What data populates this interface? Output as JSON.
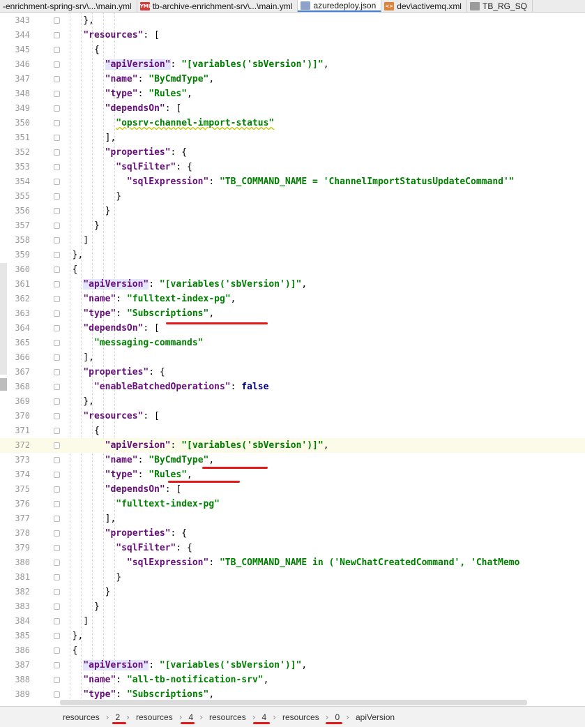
{
  "tabs": [
    {
      "label": "-enrichment-spring-srv\\...\\main.yml",
      "icon": "",
      "active": false
    },
    {
      "label": "tb-archive-enrichment-srv\\...\\main.yml",
      "icon": "yml",
      "active": false
    },
    {
      "label": "azuredeploy.json",
      "icon": "json",
      "active": true
    },
    {
      "label": "dev\\activemq.xml",
      "icon": "xml",
      "active": false
    },
    {
      "label": "TB_RG_SQ",
      "icon": "cfg",
      "active": false
    }
  ],
  "editor": {
    "current_line": 372,
    "lines": [
      {
        "n": "343",
        "segs": [
          {
            "t": "    },"
          }
        ]
      },
      {
        "n": "344",
        "segs": [
          {
            "t": "    "
          },
          {
            "t": "\"resources\"",
            "c": "key"
          },
          {
            "t": ": ["
          }
        ]
      },
      {
        "n": "345",
        "segs": [
          {
            "t": "      {"
          }
        ]
      },
      {
        "n": "346",
        "segs": [
          {
            "t": "        "
          },
          {
            "t": "\"apiVersion\"",
            "c": "key hl"
          },
          {
            "t": ": "
          },
          {
            "t": "\"[variables('sbVersion')]\"",
            "c": "str"
          },
          {
            "t": ","
          }
        ]
      },
      {
        "n": "347",
        "segs": [
          {
            "t": "        "
          },
          {
            "t": "\"name\"",
            "c": "key"
          },
          {
            "t": ": "
          },
          {
            "t": "\"ByCmdType\"",
            "c": "str"
          },
          {
            "t": ","
          }
        ]
      },
      {
        "n": "348",
        "segs": [
          {
            "t": "        "
          },
          {
            "t": "\"type\"",
            "c": "key"
          },
          {
            "t": ": "
          },
          {
            "t": "\"Rules\"",
            "c": "str"
          },
          {
            "t": ","
          }
        ]
      },
      {
        "n": "349",
        "segs": [
          {
            "t": "        "
          },
          {
            "t": "\"dependsOn\"",
            "c": "key"
          },
          {
            "t": ": ["
          }
        ]
      },
      {
        "n": "350",
        "segs": [
          {
            "t": "          "
          },
          {
            "t": "\"opsrv-channel-import-status\"",
            "c": "str warn"
          }
        ]
      },
      {
        "n": "351",
        "segs": [
          {
            "t": "        ],"
          }
        ]
      },
      {
        "n": "352",
        "segs": [
          {
            "t": "        "
          },
          {
            "t": "\"properties\"",
            "c": "key"
          },
          {
            "t": ": {"
          }
        ]
      },
      {
        "n": "353",
        "segs": [
          {
            "t": "          "
          },
          {
            "t": "\"sqlFilter\"",
            "c": "key"
          },
          {
            "t": ": {"
          }
        ]
      },
      {
        "n": "354",
        "segs": [
          {
            "t": "            "
          },
          {
            "t": "\"sqlExpression\"",
            "c": "key"
          },
          {
            "t": ": "
          },
          {
            "t": "\"TB_COMMAND_NAME = 'ChannelImportStatusUpdateCommand'\"",
            "c": "str"
          }
        ]
      },
      {
        "n": "355",
        "segs": [
          {
            "t": "          }"
          }
        ]
      },
      {
        "n": "356",
        "segs": [
          {
            "t": "        }"
          }
        ]
      },
      {
        "n": "357",
        "segs": [
          {
            "t": "      }"
          }
        ]
      },
      {
        "n": "358",
        "segs": [
          {
            "t": "    ]"
          }
        ]
      },
      {
        "n": "359",
        "segs": [
          {
            "t": "  },"
          }
        ]
      },
      {
        "n": "360",
        "segs": [
          {
            "t": "  {"
          }
        ]
      },
      {
        "n": "361",
        "segs": [
          {
            "t": "    "
          },
          {
            "t": "\"apiVersion\"",
            "c": "key hl"
          },
          {
            "t": ": "
          },
          {
            "t": "\"[variables('sbVersion')]\"",
            "c": "str"
          },
          {
            "t": ","
          }
        ]
      },
      {
        "n": "362",
        "segs": [
          {
            "t": "    "
          },
          {
            "t": "\"name\"",
            "c": "key"
          },
          {
            "t": ": "
          },
          {
            "t": "\"fulltext-index-pg\"",
            "c": "str"
          },
          {
            "t": ","
          }
        ]
      },
      {
        "n": "363",
        "segs": [
          {
            "t": "    "
          },
          {
            "t": "\"type\"",
            "c": "key"
          },
          {
            "t": ": "
          },
          {
            "t": "\"Subscriptions\"",
            "c": "str"
          },
          {
            "t": ","
          }
        ]
      },
      {
        "n": "364",
        "segs": [
          {
            "t": "    "
          },
          {
            "t": "\"dependsOn\"",
            "c": "key"
          },
          {
            "t": ": ["
          }
        ]
      },
      {
        "n": "365",
        "segs": [
          {
            "t": "      "
          },
          {
            "t": "\"messaging-commands\"",
            "c": "str"
          }
        ]
      },
      {
        "n": "366",
        "segs": [
          {
            "t": "    ],"
          }
        ]
      },
      {
        "n": "367",
        "segs": [
          {
            "t": "    "
          },
          {
            "t": "\"properties\"",
            "c": "key"
          },
          {
            "t": ": {"
          }
        ]
      },
      {
        "n": "368",
        "segs": [
          {
            "t": "      "
          },
          {
            "t": "\"enableBatchedOperations\"",
            "c": "key"
          },
          {
            "t": ": "
          },
          {
            "t": "false",
            "c": "kw"
          }
        ]
      },
      {
        "n": "369",
        "segs": [
          {
            "t": "    },"
          }
        ]
      },
      {
        "n": "370",
        "segs": [
          {
            "t": "    "
          },
          {
            "t": "\"resources\"",
            "c": "key"
          },
          {
            "t": ": ["
          }
        ]
      },
      {
        "n": "371",
        "segs": [
          {
            "t": "      {"
          }
        ]
      },
      {
        "n": "372",
        "segs": [
          {
            "t": "        "
          },
          {
            "t": "\"apiVersion\"",
            "c": "key"
          },
          {
            "t": ": "
          },
          {
            "t": "\"[variables('sbVersion')]\"",
            "c": "str"
          },
          {
            "t": ","
          }
        ]
      },
      {
        "n": "373",
        "segs": [
          {
            "t": "        "
          },
          {
            "t": "\"name\"",
            "c": "key"
          },
          {
            "t": ": "
          },
          {
            "t": "\"ByCmdType\"",
            "c": "str"
          },
          {
            "t": ","
          }
        ]
      },
      {
        "n": "374",
        "segs": [
          {
            "t": "        "
          },
          {
            "t": "\"type\"",
            "c": "key"
          },
          {
            "t": ": "
          },
          {
            "t": "\"Rules\"",
            "c": "str"
          },
          {
            "t": ","
          }
        ]
      },
      {
        "n": "375",
        "segs": [
          {
            "t": "        "
          },
          {
            "t": "\"dependsOn\"",
            "c": "key"
          },
          {
            "t": ": ["
          }
        ]
      },
      {
        "n": "376",
        "segs": [
          {
            "t": "          "
          },
          {
            "t": "\"fulltext-index-pg\"",
            "c": "str"
          }
        ]
      },
      {
        "n": "377",
        "segs": [
          {
            "t": "        ],"
          }
        ]
      },
      {
        "n": "378",
        "segs": [
          {
            "t": "        "
          },
          {
            "t": "\"properties\"",
            "c": "key"
          },
          {
            "t": ": {"
          }
        ]
      },
      {
        "n": "379",
        "segs": [
          {
            "t": "          "
          },
          {
            "t": "\"sqlFilter\"",
            "c": "key"
          },
          {
            "t": ": {"
          }
        ]
      },
      {
        "n": "380",
        "segs": [
          {
            "t": "            "
          },
          {
            "t": "\"sqlExpression\"",
            "c": "key"
          },
          {
            "t": ": "
          },
          {
            "t": "\"TB_COMMAND_NAME in ('NewChatCreatedCommand', 'ChatMemo",
            "c": "str"
          }
        ]
      },
      {
        "n": "381",
        "segs": [
          {
            "t": "          }"
          }
        ]
      },
      {
        "n": "382",
        "segs": [
          {
            "t": "        }"
          }
        ]
      },
      {
        "n": "383",
        "segs": [
          {
            "t": "      }"
          }
        ]
      },
      {
        "n": "384",
        "segs": [
          {
            "t": "    ]"
          }
        ]
      },
      {
        "n": "385",
        "segs": [
          {
            "t": "  },"
          }
        ]
      },
      {
        "n": "386",
        "segs": [
          {
            "t": "  {"
          }
        ]
      },
      {
        "n": "387",
        "segs": [
          {
            "t": "    "
          },
          {
            "t": "\"apiVersion\"",
            "c": "key hl"
          },
          {
            "t": ": "
          },
          {
            "t": "\"[variables('sbVersion')]\"",
            "c": "str"
          },
          {
            "t": ","
          }
        ]
      },
      {
        "n": "388",
        "segs": [
          {
            "t": "    "
          },
          {
            "t": "\"name\"",
            "c": "key"
          },
          {
            "t": ": "
          },
          {
            "t": "\"all-tb-notification-srv\"",
            "c": "str"
          },
          {
            "t": ","
          }
        ]
      },
      {
        "n": "389",
        "segs": [
          {
            "t": "    "
          },
          {
            "t": "\"type\"",
            "c": "key"
          },
          {
            "t": ": "
          },
          {
            "t": "\"Subscriptions\"",
            "c": "str"
          },
          {
            "t": ","
          }
        ]
      }
    ]
  },
  "breadcrumb": [
    "resources",
    "2",
    "resources",
    "4",
    "resources",
    "4",
    "resources",
    "0",
    "apiVersion"
  ],
  "breadcrumb_separator": "›",
  "colors": {
    "annotation": "#e11919",
    "active_tab": "#3d7ef0",
    "key": "#660e7a",
    "string": "#008000",
    "keyword": "#000080"
  }
}
